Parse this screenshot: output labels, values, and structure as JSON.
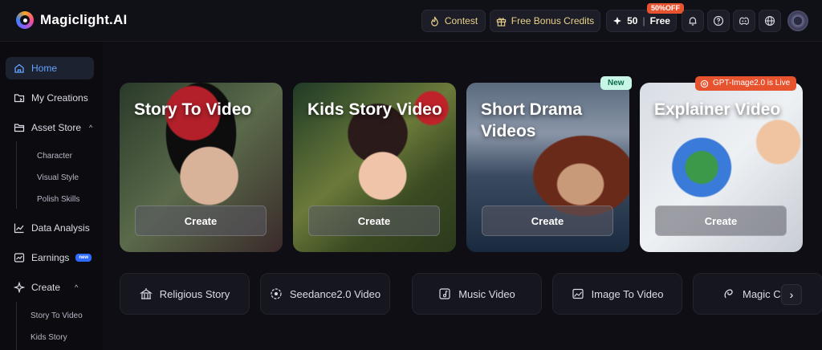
{
  "app": {
    "brand": "Magiclight.AI"
  },
  "topbar": {
    "contest_label": "Contest",
    "bonus_label": "Free Bonus Credits",
    "credits_value": "50",
    "credits_sep": "|",
    "credits_plan": "Free",
    "discount_badge": "50%OFF"
  },
  "sidebar": {
    "home": "Home",
    "my_creations": "My Creations",
    "asset_store": "Asset Store",
    "asset_store_sub": [
      "Character",
      "Visual Style",
      "Polish Skills"
    ],
    "data_analysis": "Data Analysis",
    "earnings": "Earnings",
    "earnings_badge": "new",
    "create": "Create",
    "create_sub": [
      "Story To Video",
      "Kids Story"
    ]
  },
  "cards": [
    {
      "title": "Story To Video",
      "button": "Create"
    },
    {
      "title": "Kids Story Video",
      "button": "Create"
    },
    {
      "title": "Short Drama Videos",
      "button": "Create"
    },
    {
      "title": "Explainer Video",
      "button": "Create"
    }
  ],
  "badges": {
    "new": "New",
    "gpt": "GPT-Image2.0 is Live"
  },
  "quick_actions": [
    "Religious Story",
    "Seedance2.0 Video",
    "Music Video",
    "Image To Video",
    "Magic Cli"
  ],
  "colors": {
    "accent_blue": "#66a3ff",
    "discount": "#e8532f",
    "gold_text": "#e8d28a"
  }
}
